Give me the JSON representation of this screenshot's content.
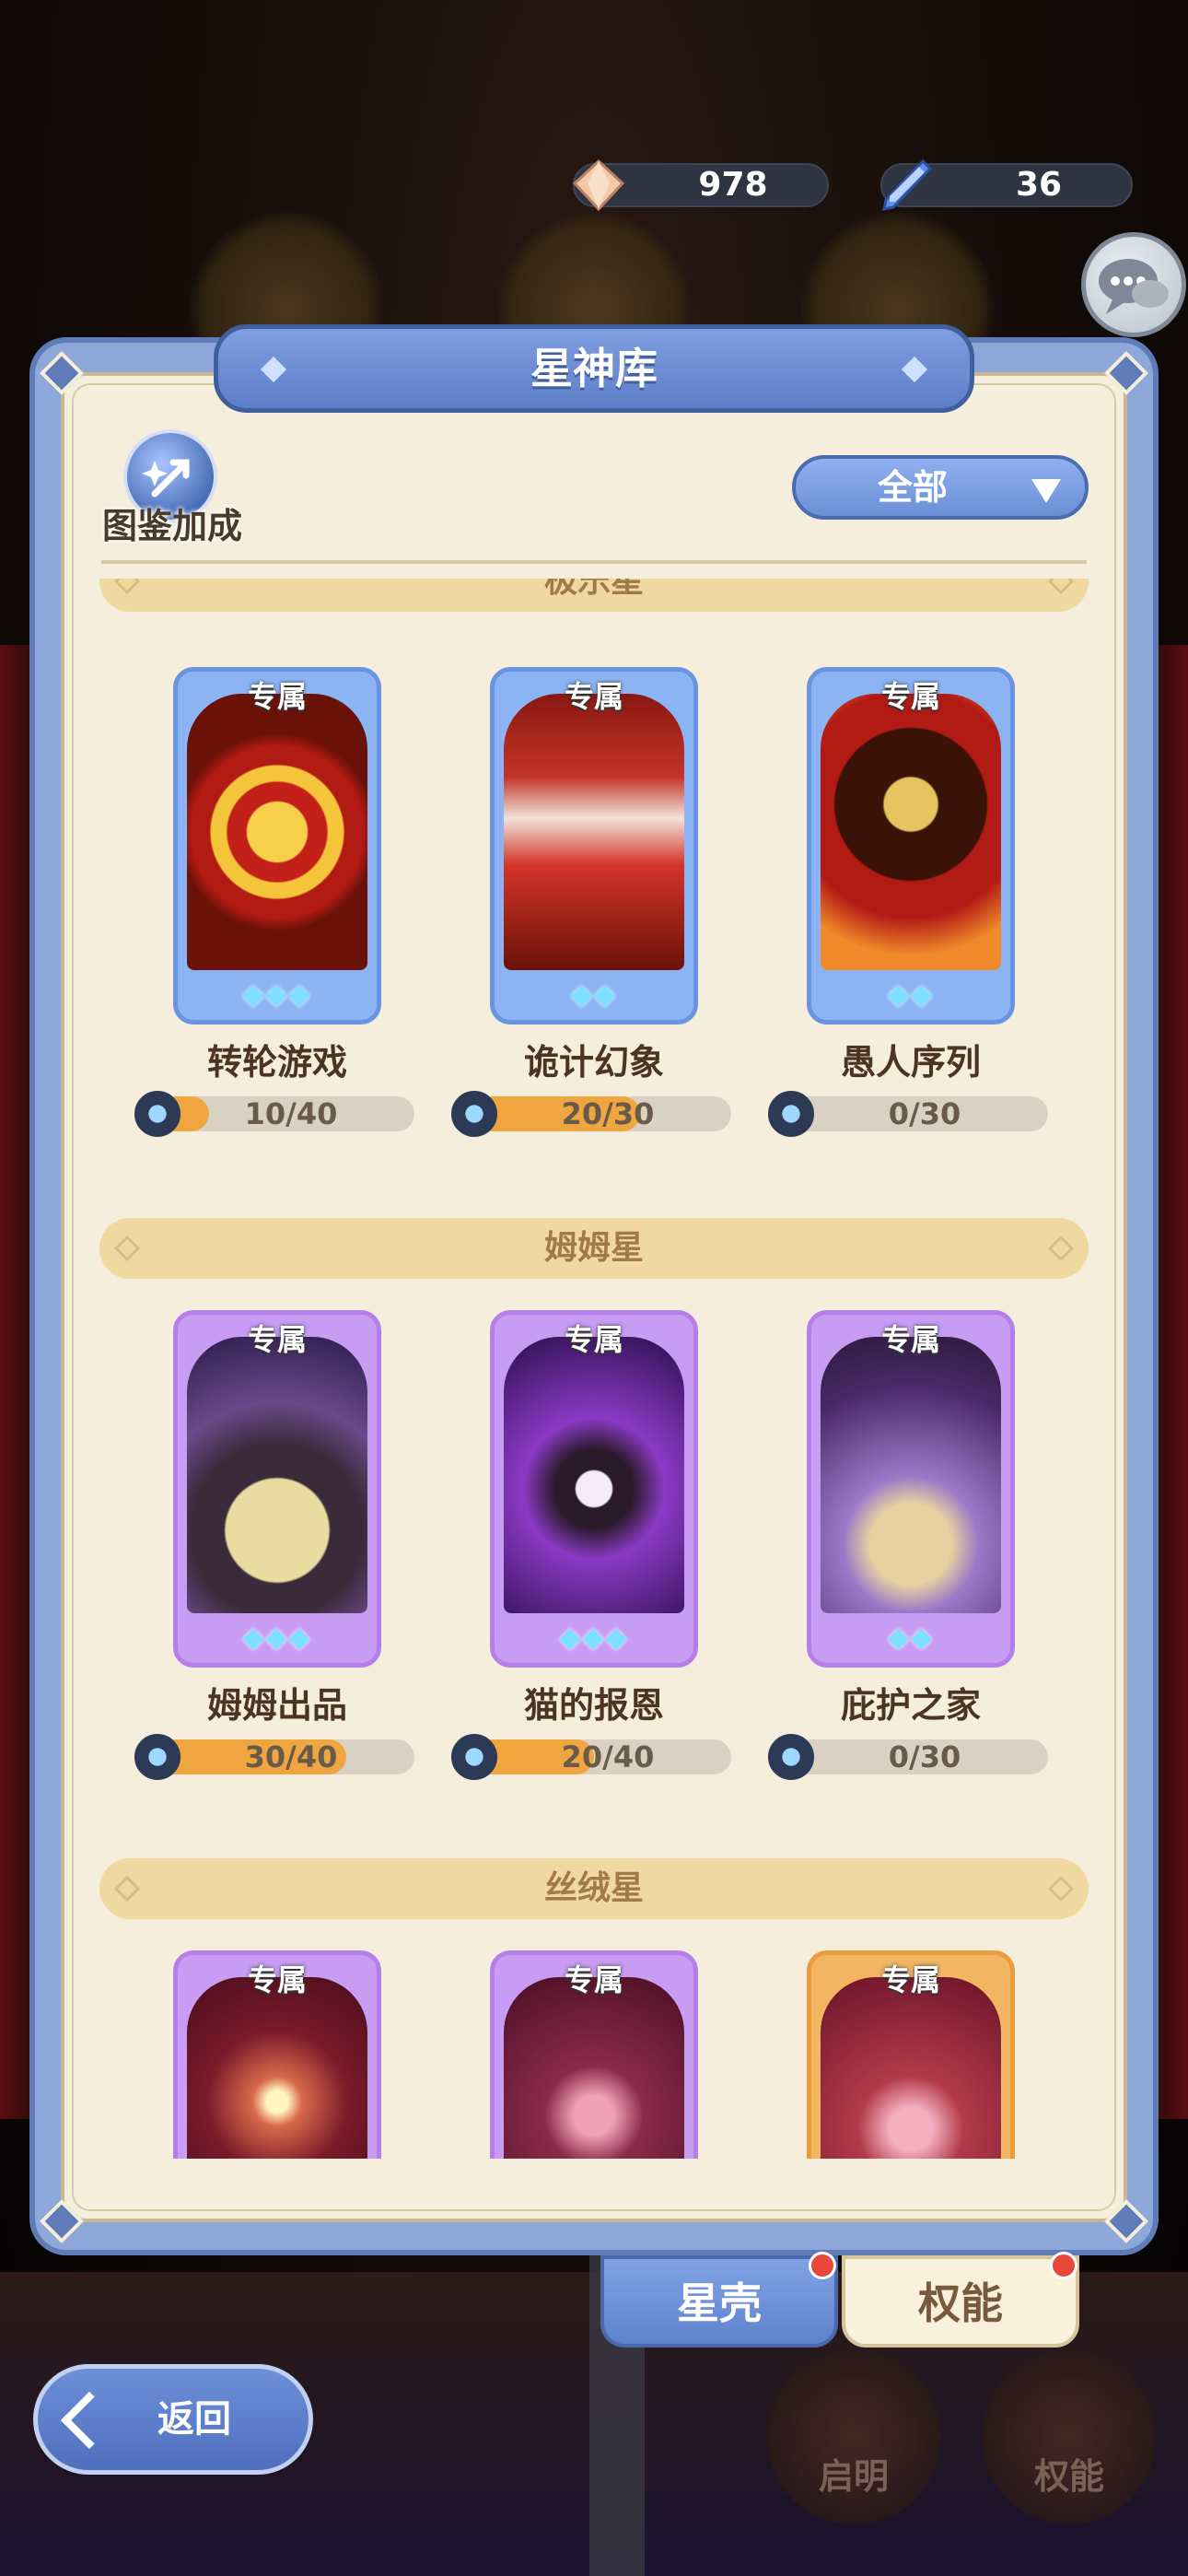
{
  "resources": {
    "gem_count": "978",
    "ticket_count": "36"
  },
  "panel": {
    "title": "星神库",
    "bonus_label": "图鉴加成",
    "filter_label": "全部"
  },
  "sections": [
    {
      "name": "极乐星",
      "cards": [
        {
          "tag": "专属",
          "name": "转轮游戏",
          "stars": "◆◆◆",
          "progress_text": "10/40",
          "progress": 0.25
        },
        {
          "tag": "专属",
          "name": "诡计幻象",
          "stars": "◆◆",
          "progress_text": "20/30",
          "progress": 0.667
        },
        {
          "tag": "专属",
          "name": "愚人序列",
          "stars": "◆◆",
          "progress_text": "0/30",
          "progress": 0
        }
      ]
    },
    {
      "name": "姆姆星",
      "cards": [
        {
          "tag": "专属",
          "name": "姆姆出品",
          "stars": "◆◆◆",
          "progress_text": "30/40",
          "progress": 0.75
        },
        {
          "tag": "专属",
          "name": "猫的报恩",
          "stars": "◆◆◆",
          "progress_text": "20/40",
          "progress": 0.5
        },
        {
          "tag": "专属",
          "name": "庇护之家",
          "stars": "◆◆",
          "progress_text": "0/30",
          "progress": 0
        }
      ]
    },
    {
      "name": "丝绒星",
      "cards": [
        {
          "tag": "专属"
        },
        {
          "tag": "专属"
        },
        {
          "tag": "专属"
        }
      ]
    }
  ],
  "tabs": {
    "star_shell": "星壳",
    "power": "权能"
  },
  "back_label": "返回",
  "bottom_buttons": {
    "dawn": "启明",
    "power": "权能"
  },
  "colors": {
    "panel_blue": "#8da7d8",
    "panel_cream": "#f6eedc",
    "progress_orange": "#f0a640",
    "notification_red": "#e8483a"
  }
}
